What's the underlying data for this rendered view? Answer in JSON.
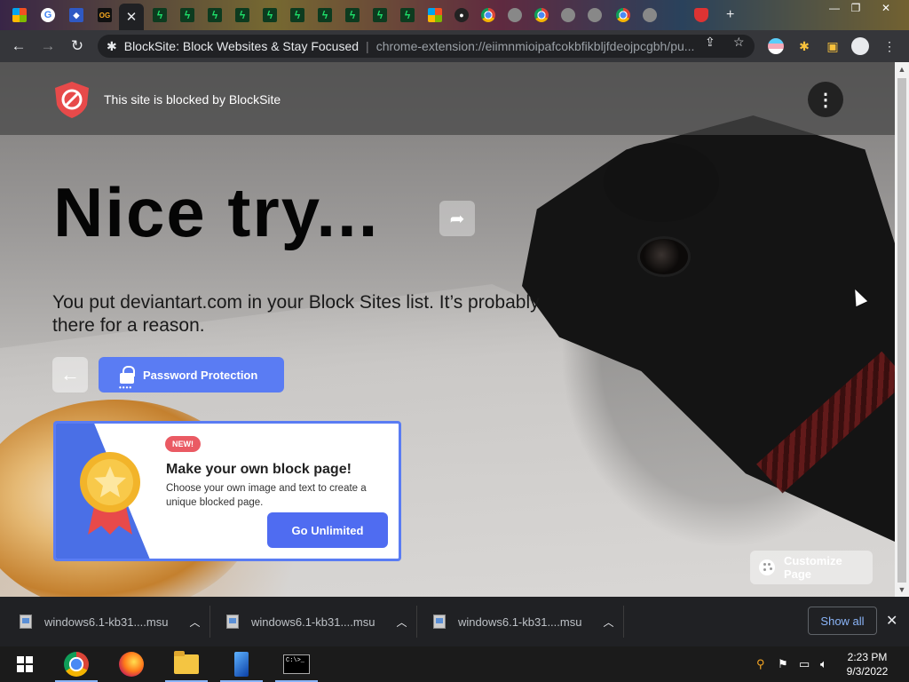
{
  "browser": {
    "omnibox": {
      "site_name": "BlockSite: Block Websites & Stay Focused",
      "url": "chrome-extension://eiimnmioipafcokbfikbljfdeojpcgbh/pu..."
    },
    "tabs": [
      {
        "icon": "microsoft-icon"
      },
      {
        "icon": "google-icon"
      },
      {
        "icon": "blue-app-icon"
      },
      {
        "icon": "og-icon"
      },
      {
        "icon": "close-icon",
        "active": true
      },
      {
        "icon": "green-bolt-icon"
      },
      {
        "icon": "green-bolt-icon"
      },
      {
        "icon": "green-bolt-icon"
      },
      {
        "icon": "green-bolt-icon"
      },
      {
        "icon": "green-bolt-icon"
      },
      {
        "icon": "green-bolt-icon"
      },
      {
        "icon": "green-bolt-icon"
      },
      {
        "icon": "green-bolt-icon"
      },
      {
        "icon": "green-bolt-icon"
      },
      {
        "icon": "green-bolt-icon"
      },
      {
        "icon": "microsoft-icon"
      },
      {
        "icon": "github-icon"
      },
      {
        "icon": "chrome-icon"
      },
      {
        "icon": "gray-tab-icon"
      },
      {
        "icon": "chrome-icon"
      },
      {
        "icon": "gray-tab-icon"
      },
      {
        "icon": "gray-tab-icon"
      },
      {
        "icon": "chrome-icon"
      },
      {
        "icon": "image-tab-icon"
      },
      {
        "icon": "shield-tab-icon"
      }
    ]
  },
  "page": {
    "brand_text": "This site is blocked by BlockSite",
    "headline": "Nice try...",
    "subtext": "You put deviantart.com in your Block Sites list. It’s probably there for a reason.",
    "password_button": "Password Protection",
    "promo": {
      "badge": "NEW!",
      "title": "Make your own block page!",
      "description": "Choose your own image and text to create a unique blocked page.",
      "cta": "Go Unlimited"
    },
    "customize_button": "Customize Page"
  },
  "downloads": {
    "items": [
      {
        "filename": "windows6.1-kb31....msu"
      },
      {
        "filename": "windows6.1-kb31....msu"
      },
      {
        "filename": "windows6.1-kb31....msu"
      }
    ],
    "show_all": "Show all"
  },
  "taskbar": {
    "time": "2:23 PM",
    "date": "9/3/2022",
    "cmd_text": "C:\\>_"
  },
  "colors": {
    "accent": "#5a7cf3",
    "badge_new": "#ea5a63",
    "shelf_link": "#8ab4f8"
  }
}
